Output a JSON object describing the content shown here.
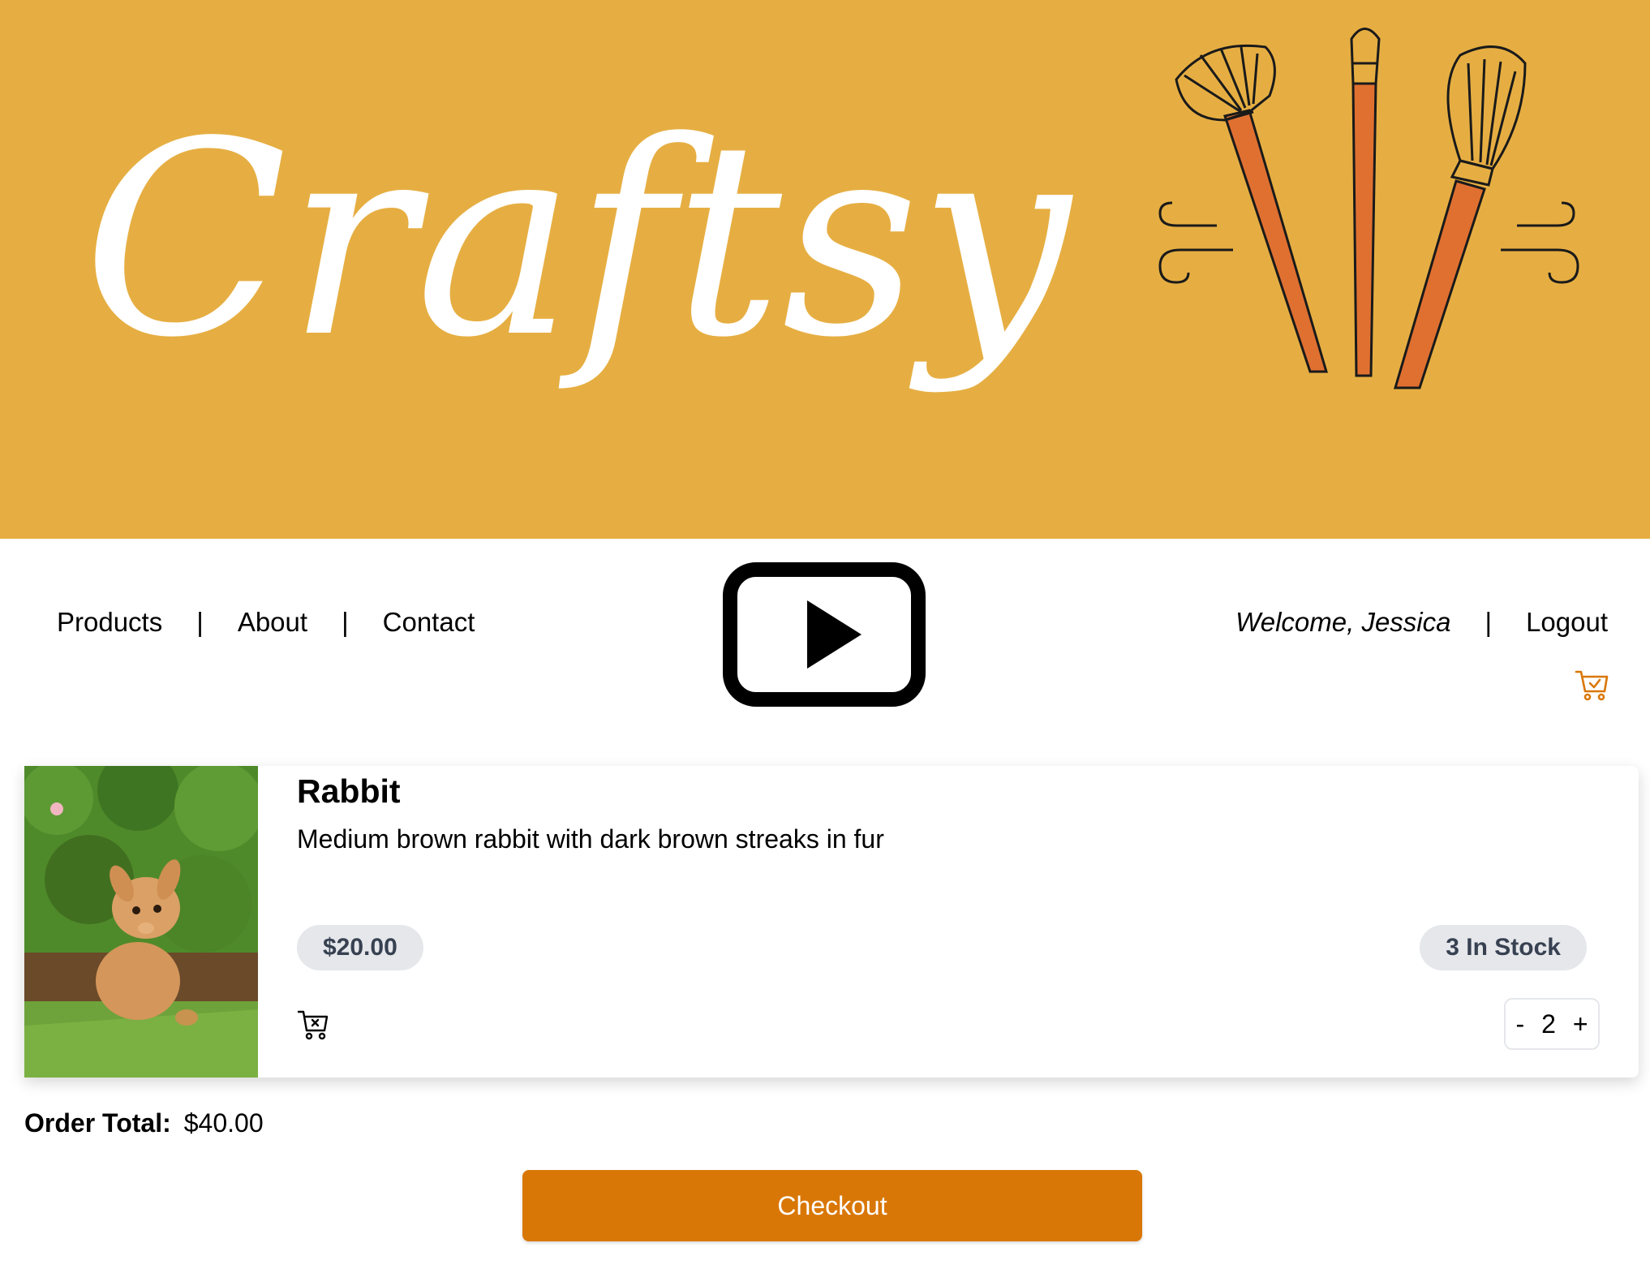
{
  "brand": {
    "name": "Craftsy",
    "banner_color": "#e6ae42",
    "brush_color": "#e07030"
  },
  "nav": {
    "links": [
      "Products",
      "About",
      "Contact"
    ],
    "separator": "|",
    "welcome": "Welcome, Jessica",
    "logout": "Logout",
    "cart_icon": "cart-check-icon",
    "center_icon": "video-play-icon"
  },
  "cart_items": [
    {
      "name": "Rabbit",
      "description": "Medium brown rabbit with dark brown streaks in fur",
      "price": "$20.00",
      "stock": "3 In Stock",
      "quantity": "2",
      "remove_icon": "cart-remove-icon"
    }
  ],
  "stepper": {
    "minus": "-",
    "plus": "+"
  },
  "order": {
    "total_label": "Order Total:",
    "total_value": "$40.00"
  },
  "checkout": {
    "label": "Checkout",
    "color": "#d97706"
  }
}
